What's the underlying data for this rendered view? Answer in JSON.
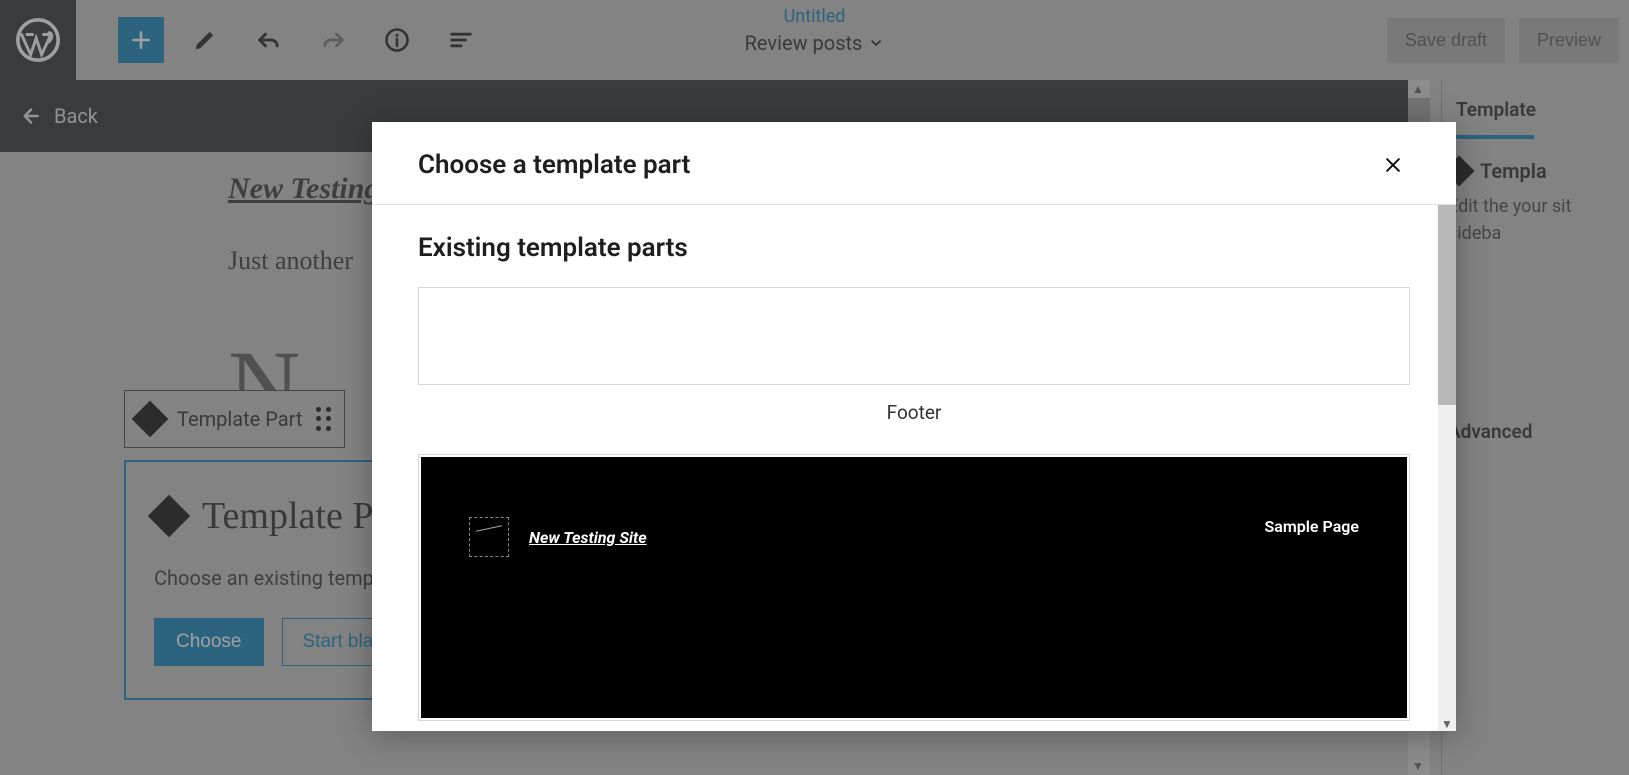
{
  "header": {
    "doc_title": "Untitled",
    "doc_sub": "Review posts",
    "save_draft": "Save draft",
    "preview": "Preview"
  },
  "back_bar": {
    "label": "Back"
  },
  "canvas": {
    "site_title": "New Testing",
    "tagline": "Just another",
    "big_letters": "N T"
  },
  "block_toolbar": {
    "label": "Template Part"
  },
  "tp_panel": {
    "title": "Template P",
    "desc": "Choose an existing templat",
    "choose": "Choose",
    "start_blank": "Start blank"
  },
  "sidebar": {
    "tab": "Template",
    "block_name": "Templa",
    "desc": "Edit the your sit sideba",
    "advanced": "Advanced"
  },
  "modal": {
    "title": "Choose a template part",
    "section_title": "Existing template parts",
    "items": [
      {
        "label": "Footer"
      }
    ],
    "header_preview": {
      "site_name": "New Testing Site",
      "nav_item": "Sample Page"
    }
  }
}
